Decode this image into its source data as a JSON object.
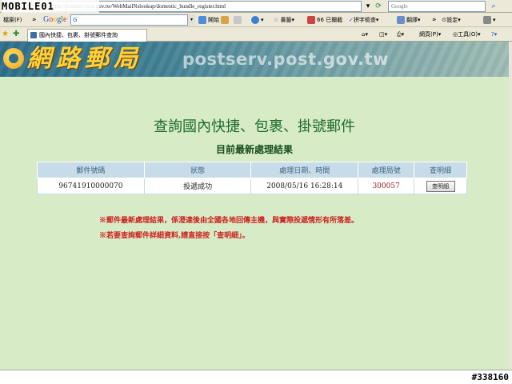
{
  "watermark": {
    "site_logo": "MOBILE01",
    "image_id": "#338160"
  },
  "browser": {
    "address": "http://postserv.post.gov.tw/WebMailNslookup/domestic_bundle_register.html",
    "search_placeholder": "Google",
    "menu": {
      "favorites": "檔案(F)"
    },
    "google_toolbar": {
      "logo": [
        "G",
        "o",
        "o",
        "g",
        "l",
        "e"
      ],
      "query": "G",
      "go": "開始",
      "bookmarks": "書籤",
      "blocked": "66 已攔截",
      "spellcheck": "拼字檢查",
      "translate": "翻譯",
      "settings": "設定"
    },
    "tab_title": "國內快捷、包裹、掛號郵件查詢",
    "commands": {
      "page": "網頁(P)",
      "tools": "工具(O)"
    }
  },
  "page": {
    "banner_title": "網路郵局",
    "banner_url": "postserv.post.gov.tw",
    "heading": "查詢國內快捷、包裹、掛號郵件",
    "subheading": "目前最新處理結果",
    "table": {
      "headers": [
        "郵件號碼",
        "狀態",
        "處理日期、時間",
        "處理局號",
        "查明細"
      ],
      "rows": [
        {
          "number": "96741910000070",
          "status": "投遞成功",
          "datetime": "2008/05/16 16:28:14",
          "office": "300057",
          "detail": "查明細"
        }
      ]
    },
    "notes": [
      "※郵件最新處理結果，係澄達後由全國各地回傳主機，與實際投遞情形有所落差。",
      "※若要查詢郵件詳細資料,請直接按「查明細」。"
    ]
  },
  "colors": {
    "heading": "#1f6a2e",
    "note": "#cc1f1f",
    "page_bg": "#d7ecc6",
    "table_header": "#c7dbe8"
  }
}
